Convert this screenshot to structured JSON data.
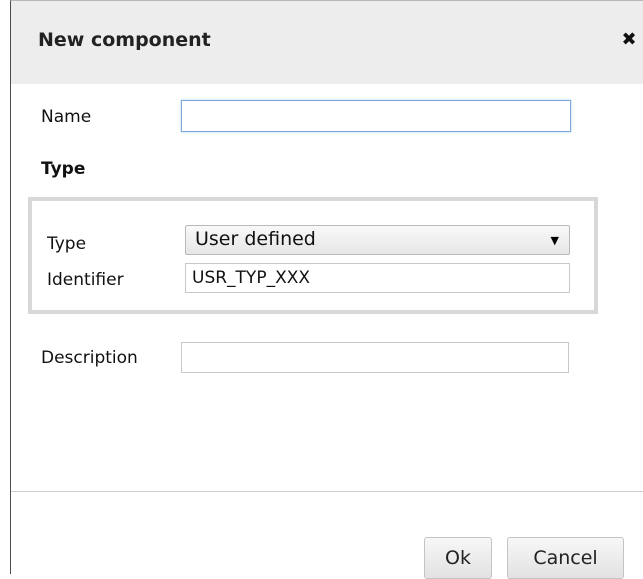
{
  "dialog": {
    "title": "New component",
    "close_icon": "close-icon"
  },
  "form": {
    "name_label": "Name",
    "name_value": "",
    "type_section_title": "Type",
    "type_label": "Type",
    "type_selected": "User defined",
    "identifier_label": "Identifier",
    "identifier_value": "USR_TYP_XXX",
    "description_label": "Description",
    "description_value": ""
  },
  "buttons": {
    "ok_label": "Ok",
    "cancel_label": "Cancel"
  },
  "colors": {
    "titlebar": "#ededed",
    "focus_border": "#7ea9d9"
  }
}
